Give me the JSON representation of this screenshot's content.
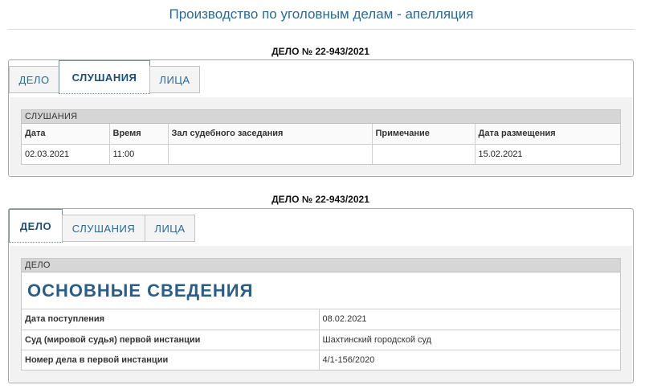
{
  "page": {
    "title": "Производство по уголовным делам - апелляция"
  },
  "case_number_heading": "ДЕЛО № 22-943/2021",
  "tabs": {
    "delo": "ДЕЛО",
    "hearings": "СЛУШАНИЯ",
    "persons": "ЛИЦА"
  },
  "hearings_section": {
    "header": "СЛУШАНИЯ",
    "columns": [
      "Дата",
      "Время",
      "Зал судебного заседания",
      "Примечание",
      "Дата размещения"
    ],
    "rows": [
      [
        "02.03.2021",
        "11:00",
        "",
        "",
        "15.02.2021"
      ]
    ]
  },
  "case_section": {
    "header": "ДЕЛО",
    "title": "ОСНОВНЫЕ СВЕДЕНИЯ",
    "fields": [
      {
        "label": "Дата поступления",
        "value": "08.02.2021"
      },
      {
        "label": "Суд (мировой судья) первой инстанции",
        "value": "Шахтинский городской суд"
      },
      {
        "label": "Номер дела в первой инстанции",
        "value": "4/1-156/2020"
      }
    ]
  },
  "colors": {
    "accent": "#2c6a93",
    "heading": "#2c5d84"
  }
}
